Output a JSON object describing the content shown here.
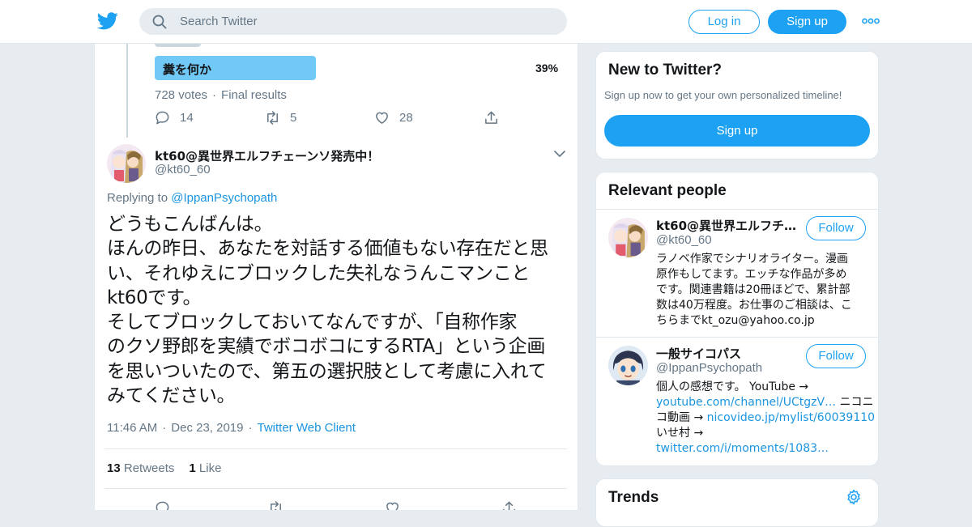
{
  "header": {
    "search_placeholder": "Search Twitter",
    "login_label": "Log in",
    "signup_label": "Sign up"
  },
  "poll": {
    "option_label": "糞を何か",
    "option_percent": "39%",
    "votes": "728 votes",
    "status": "Final results",
    "reply_count": "14",
    "retweet_count": "5",
    "like_count": "28"
  },
  "tweet": {
    "author_name": "kt60@異世界エルフチェーンソ発売中！",
    "author_handle": "@kt60_60",
    "replying_prefix": "Replying to",
    "replying_to": "@IppanPsychopath",
    "text_lines": [
      "どうもこんばんは。",
      "ほんの昨日、あなたを対話する価値もない存在だと思",
      "い、それゆえにブロックした失礼なうんこマンこと",
      "kt60です。",
      "そしてブロックしておいてなんですが、「自称作家",
      "のクソ野郎を実績でボコボコにするRTA」という企画",
      "を思いついたので、第五の選択肢として考慮に入れて",
      "みてください。"
    ],
    "time": "11:46 AM",
    "date": "Dec 23, 2019",
    "client": "Twitter Web Client",
    "retweets_count": "13",
    "retweets_label": "Retweets",
    "likes_count": "1",
    "likes_label": "Like"
  },
  "sidebar": {
    "new_title": "New to Twitter?",
    "new_subtitle": "Sign up now to get your own personalized timeline!",
    "new_signup_label": "Sign up",
    "relevant_title": "Relevant people",
    "people": [
      {
        "name": "kt60@異世界エルフチェ…",
        "handle": "@kt60_60",
        "follow_label": "Follow",
        "bio_lines": [
          "ラノベ作家でシナリオライター。漫画",
          "原作もしてます。エッチな作品が多め",
          "です。関連書籍は20冊ほどで、累計部",
          "数は40万程度。お仕事のご相談は、こ",
          "ちらまでkt_ozu@yahoo.co.jp"
        ]
      },
      {
        "name": "一般サイコパス",
        "handle": "@IppanPsychopath",
        "follow_label": "Follow",
        "bio_line1": "個人の感想です。 YouTube →",
        "bio_link1": "youtube.com/channel/UCtgzV…",
        "bio_after1": " ニコニ",
        "bio_line3_prefix": "コ動画 → ",
        "bio_link2": "nicovideo.jp/mylist/60039110",
        "bio_line4": "いせ村 →",
        "bio_link3": "twitter.com/i/moments/1083…"
      }
    ],
    "trends_title": "Trends"
  },
  "colors": {
    "accent": "#1da1f2",
    "link": "#1b95e0",
    "poll_bar": "#71c9f8",
    "secondary_text": "#657786",
    "background": "#e6ecf0"
  }
}
